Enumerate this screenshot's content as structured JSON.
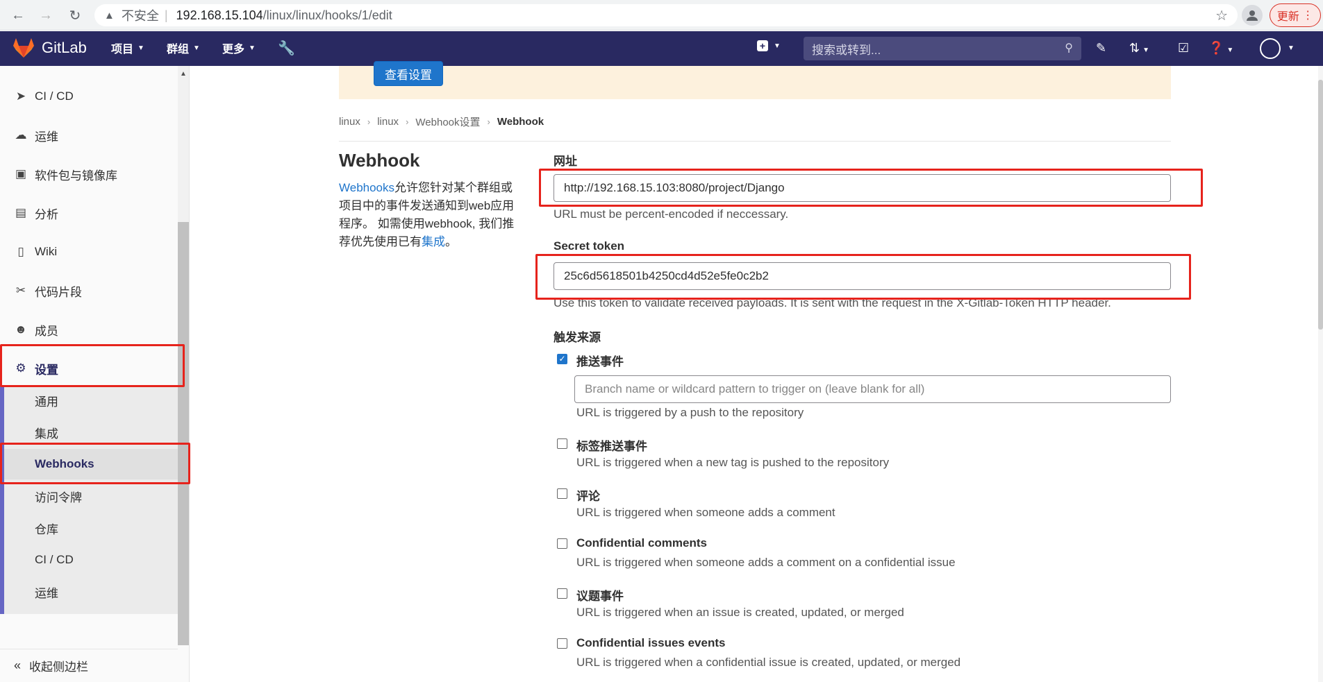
{
  "browser": {
    "insecure_label": "不安全",
    "url_host": "192.168.15.104",
    "url_path": "/linux/linux/hooks/1/edit",
    "update_label": "更新"
  },
  "topbar": {
    "brand": "GitLab",
    "menu_projects": "项目",
    "menu_groups": "群组",
    "menu_more": "更多",
    "search_placeholder": "搜索或转到..."
  },
  "sidebar": {
    "items": [
      {
        "label": "CI / CD",
        "icon": "rocket-icon"
      },
      {
        "label": "运维",
        "icon": "cloud-icon"
      },
      {
        "label": "软件包与镜像库",
        "icon": "package-icon"
      },
      {
        "label": "分析",
        "icon": "chart-icon"
      },
      {
        "label": "Wiki",
        "icon": "book-icon"
      },
      {
        "label": "代码片段",
        "icon": "scissors-icon"
      },
      {
        "label": "成员",
        "icon": "users-icon"
      },
      {
        "label": "设置",
        "icon": "gear-icon"
      }
    ],
    "sub_items": [
      "通用",
      "集成",
      "Webhooks",
      "访问令牌",
      "仓库",
      "CI / CD",
      "运维"
    ],
    "collapse_label": "收起侧边栏"
  },
  "main": {
    "view_settings_button": "查看设置",
    "breadcrumbs": [
      "linux",
      "linux",
      "Webhook设置",
      "Webhook"
    ],
    "section_title": "Webhook",
    "desc_link": "Webhooks",
    "desc_text": "允许您针对某个群组或项目中的事件发送通知到web应用程序。 如需使用webhook, 我们推荐优先使用已有",
    "desc_link2": "集成",
    "desc_end": "。",
    "url_label": "网址",
    "url_value": "http://192.168.15.103:8080/project/Django",
    "url_help": "URL must be percent-encoded if neccessary.",
    "token_label": "Secret token",
    "token_value": "25c6d5618501b4250cd4d52e5fe0c2b2",
    "token_help": "Use this token to validate received payloads. It is sent with the request in the X-Gitlab-Token HTTP header.",
    "trigger_label": "触发来源",
    "branch_placeholder": "Branch name or wildcard pattern to trigger on (leave blank for all)",
    "triggers": [
      {
        "label": "推送事件",
        "help": "URL is triggered by a push to the repository",
        "checked": true
      },
      {
        "label": "标签推送事件",
        "help": "URL is triggered when a new tag is pushed to the repository",
        "checked": false
      },
      {
        "label": "评论",
        "help": "URL is triggered when someone adds a comment",
        "checked": false
      },
      {
        "label": "Confidential comments",
        "help": "URL is triggered when someone adds a comment on a confidential issue",
        "checked": false
      },
      {
        "label": "议题事件",
        "help": "URL is triggered when an issue is created, updated, or merged",
        "checked": false
      },
      {
        "label": "Confidential issues events",
        "help": "URL is triggered when a confidential issue is created, updated, or merged",
        "checked": false
      }
    ]
  },
  "colors": {
    "topbar": "#292961",
    "accent": "#1f75cb",
    "highlight": "#e6231c"
  }
}
